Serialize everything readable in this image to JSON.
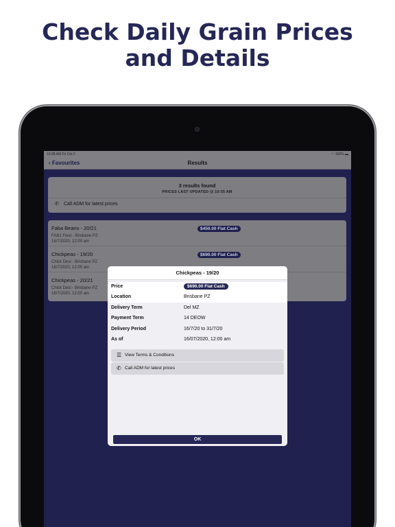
{
  "headline": {
    "line1": "Check Daily Grain Prices",
    "line2": "and Details"
  },
  "status_bar": {
    "time": "10:08 AM  Fri Oct 2",
    "battery": "100%"
  },
  "nav": {
    "back_label": "Favourites",
    "title": "Results"
  },
  "results": {
    "count": "3 results found",
    "updated": "PRICES LAST UPDATED @ 10:55 AM",
    "call_label": "Call ADM for latest prices"
  },
  "list": [
    {
      "title": "Faba Beans - 20/21",
      "subtitle": "FAB1 Fiest - Brisbane PZ",
      "date": "16/7/2020, 12:00 am",
      "price": "$450.00 Flat Cash"
    },
    {
      "title": "Chickpeas - 19/20",
      "subtitle": "Chick Desi - Brisbane PZ",
      "date": "16/7/2020, 12:00 am",
      "price": "$690.00 Flat Cash"
    },
    {
      "title": "Chickpeas - 20/21",
      "subtitle": "Chick Desi - Brisbane PZ",
      "date": "16/7/2020, 12:00 am",
      "price": ""
    }
  ],
  "modal": {
    "title": "Chickpeas - 19/20",
    "details": {
      "price_label": "Price",
      "price_value": "$690.00 Flat Cash",
      "location_label": "Location",
      "location_value": "Brisbane PZ",
      "delivery_term_label": "Delivery Term",
      "delivery_term_value": "Del MZ",
      "payment_term_label": "Payment Term",
      "payment_term_value": "14 DEOW",
      "delivery_period_label": "Delivery Period",
      "delivery_period_value": "16/7/20 to 31/7/20",
      "as_of_label": "As of",
      "as_of_value": "16/07/2020, 12:00 am"
    },
    "terms_label": "View Terms & Conditions",
    "call_label": "Call ADM for latest prices",
    "ok_label": "OK"
  },
  "colors": {
    "brand_navy": "#262756",
    "background_dim": "#20214e"
  }
}
